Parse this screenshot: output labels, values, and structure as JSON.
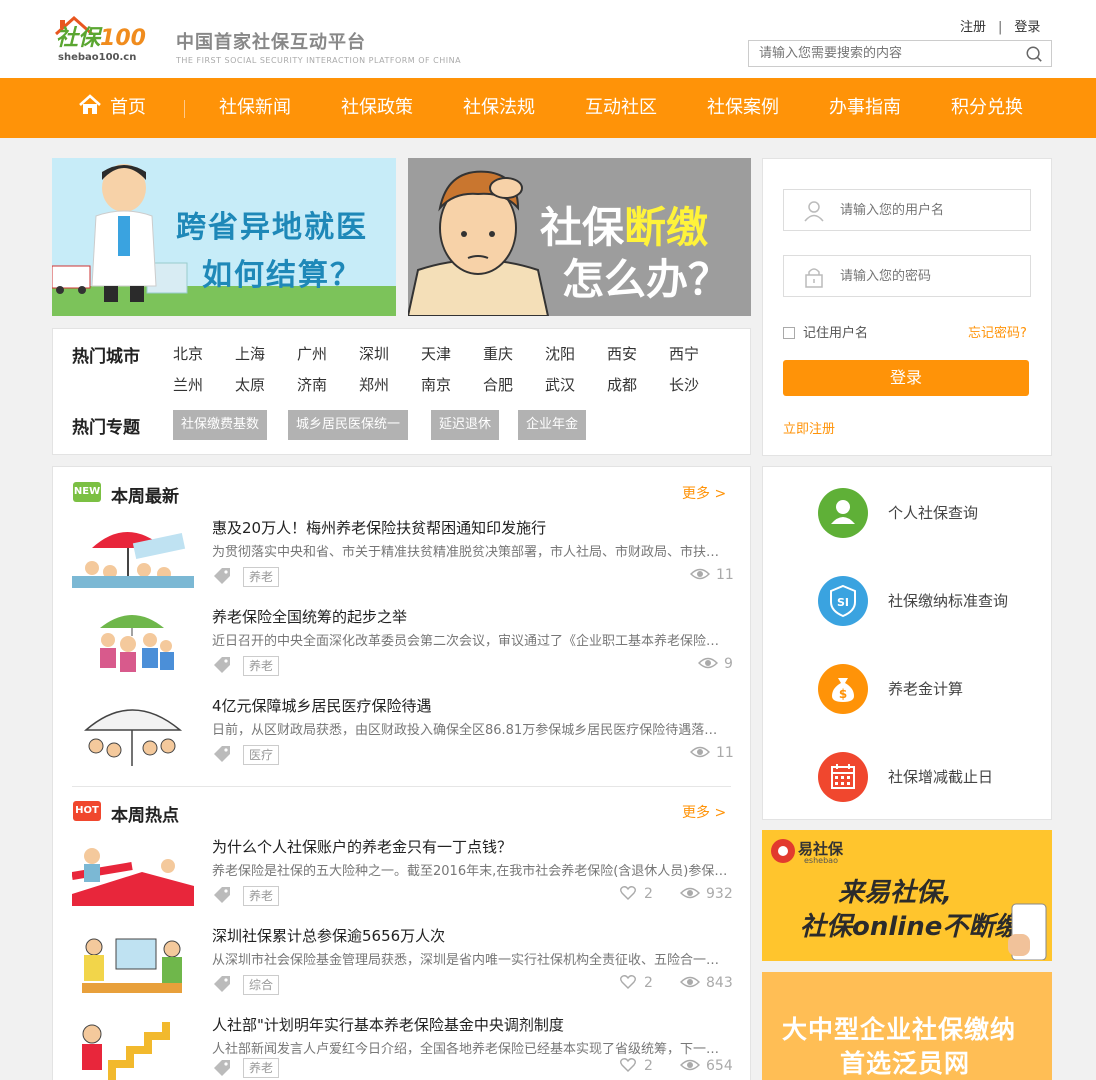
{
  "header": {
    "logo_text_a": "社保",
    "logo_text_b": "100",
    "logo_domain": "shebao100.cn",
    "slogan": "中国首家社保互动平台",
    "slogan_en": "THE FIRST SOCIAL SECURITY INTERACTION PLATFORM OF CHINA",
    "register": "注册",
    "separator": "|",
    "login": "登录",
    "search_placeholder": "请输入您需要搜索的内容"
  },
  "nav": {
    "items": [
      "首页",
      "社保新闻",
      "社保政策",
      "社保法规",
      "互动社区",
      "社保案例",
      "办事指南",
      "积分兑换"
    ]
  },
  "banners": {
    "b1_line1": "跨省异地就医",
    "b1_line2": "如何结算？",
    "b2_line1a": "社保",
    "b2_line1b": "断缴",
    "b2_line2": "怎么办？"
  },
  "hot": {
    "cities_title": "热门城市",
    "cities": [
      "北京",
      "上海",
      "广州",
      "深圳",
      "天津",
      "重庆",
      "沈阳",
      "西安",
      "西宁",
      "兰州",
      "太原",
      "济南",
      "郑州",
      "南京",
      "合肥",
      "武汉",
      "成都",
      "长沙"
    ],
    "topics_title": "热门专题",
    "topics": [
      "社保缴费基数",
      "城乡居民医保统一",
      "延迟退休",
      "企业年金"
    ]
  },
  "login": {
    "username_placeholder": "请输入您的用户名",
    "password_placeholder": "请输入您的密码",
    "remember": "记住用户名",
    "forgot": "忘记密码?",
    "button": "登录",
    "register_now": "立即注册"
  },
  "services": {
    "items": [
      "个人社保查询",
      "社保缴纳标准查询",
      "养老金计算",
      "社保增减截止日"
    ],
    "colors": [
      "#5fb037",
      "#3aa3e0",
      "#ff9308",
      "#f0472e"
    ],
    "icons": [
      "person-icon",
      "si-shield-icon",
      "money-bag-icon",
      "calendar-icon"
    ],
    "si_text": "SI",
    "money_symbol": "$"
  },
  "ads": {
    "ad1_brand": "易社保",
    "ad1_brand_sub": "eshebao",
    "ad1_line1": "来易社保,",
    "ad1_line2": "社保online不断缴",
    "ad2_line1": "大中型企业社保缴纳",
    "ad2_line2": "首选泛员网"
  },
  "news": {
    "weekly_badge": "NEW",
    "weekly_title": "本周最新",
    "hot_badge": "HOT",
    "hot_title": "本周热点",
    "more": "更多 >",
    "weekly": [
      {
        "title": "惠及20万人！梅州养老保险扶贫帮困通知印发施行",
        "desc": "为贯彻落实中央和省、市关于精准扶贫精准脱贫决策部署，市人社局、市财政局、市扶贫办联合印发通知",
        "tag": "养老",
        "views": "11"
      },
      {
        "title": "养老保险全国统筹的起步之举",
        "desc": "近日召开的中央全面深化改革委员会第二次会议，审议通过了《企业职工基本养老保险基金中央调剂制度方案》",
        "tag": "养老",
        "views": "9"
      },
      {
        "title": "4亿元保障城乡居民医疗保险待遇",
        "desc": "日前，从区财政局获悉，由区财政投入确保全区86.81万参保城乡居民医疗保险待遇落实到位",
        "tag": "医疗",
        "views": "11"
      }
    ],
    "hot": [
      {
        "title": "为什么个人社保账户的养老金只有一丁点钱？",
        "desc": "养老保险是社保的五大险种之一。截至2016年末,在我市社会养老保险(含退休人员)参保人数",
        "tag": "养老",
        "likes": "2",
        "views": "932"
      },
      {
        "title": "深圳社保累计总参保逾5656万人次",
        "desc": "从深圳市社会保险基金管理局获悉，深圳是省内唯一实行社保机构全责征收、五险合一的城市",
        "tag": "综合",
        "likes": "2",
        "views": "843"
      },
      {
        "title": "人社部\"计划明年实行基本养老保险基金中央调剂制度",
        "desc": "人社部新闻发言人卢爱红今日介绍，全国各地养老保险已经基本实现了省级统筹，下一步将推进全国统筹",
        "tag": "养老",
        "likes": "2",
        "views": "654"
      }
    ]
  }
}
